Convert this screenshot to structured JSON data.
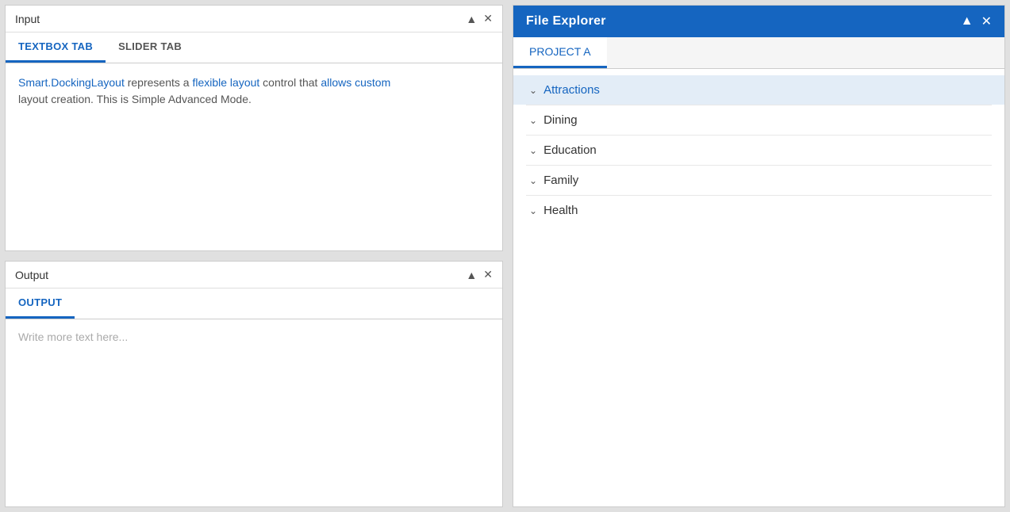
{
  "leftPanel": {
    "inputSection": {
      "title": "Input",
      "pinIcon": "📌",
      "closeIcon": "✕",
      "tabs": [
        {
          "label": "TEXTBOX TAB",
          "active": true
        },
        {
          "label": "SLIDER TAB",
          "active": false
        }
      ],
      "bodyText": {
        "part1": "Smart.DockingLayout represents a flexible layout control that allows custom layout creation. This is Simple Advanced Mode."
      }
    },
    "outputSection": {
      "title": "Output",
      "pinIcon": "📌",
      "closeIcon": "✕",
      "tabs": [
        {
          "label": "OUTPUT",
          "active": true
        }
      ],
      "placeholder": "Write more text here..."
    }
  },
  "rightPanel": {
    "title": "File Explorer",
    "pinIcon": "📌",
    "closeIcon": "✕",
    "projectTabs": [
      {
        "label": "PROJECT A",
        "active": true
      }
    ],
    "treeItems": [
      {
        "label": "Attractions",
        "selected": true
      },
      {
        "label": "Dining",
        "selected": false
      },
      {
        "label": "Education",
        "selected": false
      },
      {
        "label": "Family",
        "selected": false
      },
      {
        "label": "Health",
        "selected": false
      }
    ]
  },
  "icons": {
    "pin": "⊕",
    "close": "×",
    "chevron": "∨"
  }
}
